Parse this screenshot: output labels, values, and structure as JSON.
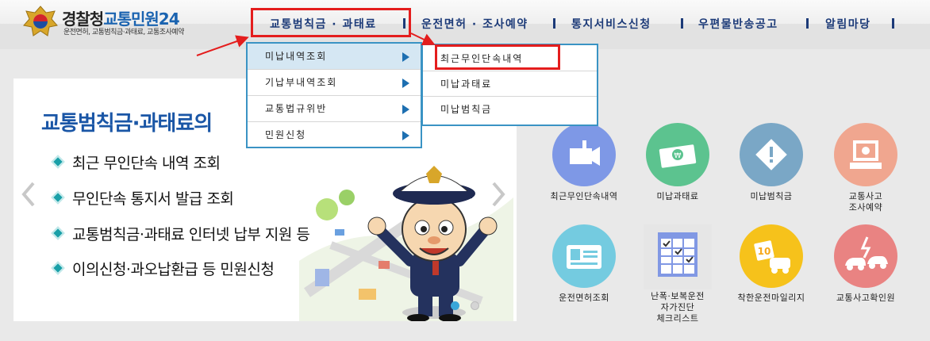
{
  "header": {
    "logo_title_part1": "경찰청",
    "logo_title_part2": "교통민원24",
    "logo_subtitle": "운전면허, 교통범칙금·과태료, 교통조사예약"
  },
  "nav": {
    "items": [
      {
        "label": "교통범칙금 · 과태료"
      },
      {
        "label": "운전면허 · 조사예약"
      },
      {
        "label": "통지서비스신청"
      },
      {
        "label": "우편물반송공고"
      },
      {
        "label": "알림마당"
      }
    ]
  },
  "submenu": {
    "items": [
      {
        "label": "미납내역조회"
      },
      {
        "label": "기납부내역조회"
      },
      {
        "label": "교통법규위반"
      },
      {
        "label": "민원신청"
      }
    ]
  },
  "subsubmenu": {
    "items": [
      {
        "label": "최근무인단속내역"
      },
      {
        "label": "미납과태료"
      },
      {
        "label": "미납범칙금"
      }
    ]
  },
  "banner": {
    "title": "교통범칙금·과태료의",
    "bullets": [
      "최근 무인단속 내역 조회",
      "무인단속 통지서 발급 조회",
      "교통범칙금·과태료 인터넷 납부 지원 등",
      "이의신청·과오납환급 등 민원신청"
    ]
  },
  "quick_menu": {
    "items": [
      {
        "label": "최근무인단속내역",
        "color": "#7e98e6",
        "icon": "camera-icon"
      },
      {
        "label": "미납과태료",
        "color": "#5cc38f",
        "icon": "money-icon"
      },
      {
        "label": "미납범칙금",
        "color": "#7aa7c6",
        "icon": "warning-icon"
      },
      {
        "label": "교통사고\n조사예약",
        "color": "#f0a68f",
        "icon": "monitor-icon"
      },
      {
        "label": "운전면허조회",
        "color": "#74cbe0",
        "icon": "license-card-icon"
      },
      {
        "label": "난폭·보복운전\n자가진단\n체크리스트",
        "color": "#8198e4",
        "icon": "checklist-icon"
      },
      {
        "label": "착한운전마일리지",
        "color": "#f6c21b",
        "icon": "mileage-icon"
      },
      {
        "label": "교통사고확인원",
        "color": "#e98382",
        "icon": "car-crash-icon"
      }
    ]
  }
}
